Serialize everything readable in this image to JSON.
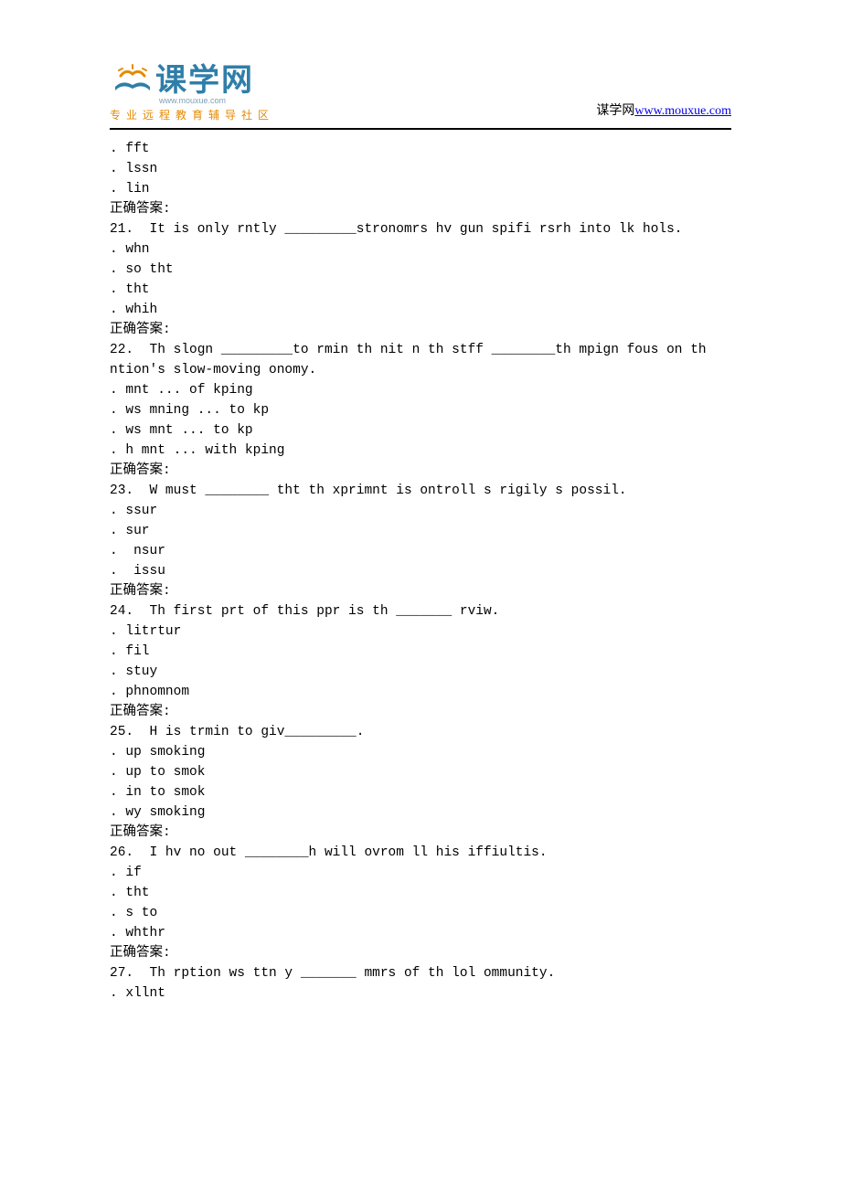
{
  "header": {
    "logo_main": "课学网",
    "logo_url": "www.mouxue.com",
    "logo_tagline": "专业远程教育辅导社区",
    "site_label": "谋学网",
    "site_url_text": "www.mouxue.com",
    "site_url_href": "http://www.mouxue.com"
  },
  "orphan_options": [
    ". fft",
    ". lssn",
    ". lin"
  ],
  "answer_label": "正确答案:",
  "questions": [
    {
      "num": "21.",
      "text": " It is only rntly _________stronomrs hv gun spifi rsrh into lk hols.",
      "options": [
        ". whn",
        ". so tht",
        ". tht",
        ". whih"
      ]
    },
    {
      "num": "22.",
      "text": " Th slogn _________to rmin th nit n th stff ________th mpign fous on th ntion's slow-moving onomy.",
      "options": [
        ". mnt ... of kping",
        ". ws mning ... to kp",
        ". ws mnt ... to kp",
        ". h mnt ... with kping"
      ]
    },
    {
      "num": "23.",
      "text": " W must ________ tht th xprimnt is ontroll s rigily s possil.",
      "options": [
        ". ssur",
        ". sur",
        ".  nsur",
        ".  issu"
      ]
    },
    {
      "num": "24.",
      "text": " Th first prt of this ppr is th _______ rviw.",
      "options": [
        ". litrtur",
        ". fil",
        ". stuy",
        ". phnomnom"
      ]
    },
    {
      "num": "25.",
      "text": " H is trmin to giv_________.",
      "options": [
        ". up smoking",
        ". up to smok",
        ". in to smok",
        ". wy smoking"
      ]
    },
    {
      "num": "26.",
      "text": " I hv no out ________h will ovrom ll his iffiultis.",
      "options": [
        ". if",
        ". tht",
        ". s to",
        ". whthr"
      ]
    },
    {
      "num": "27.",
      "text": " Th rption ws ttn y _______ mmrs of th lol ommunity.",
      "options": [
        ". xllnt"
      ]
    }
  ]
}
